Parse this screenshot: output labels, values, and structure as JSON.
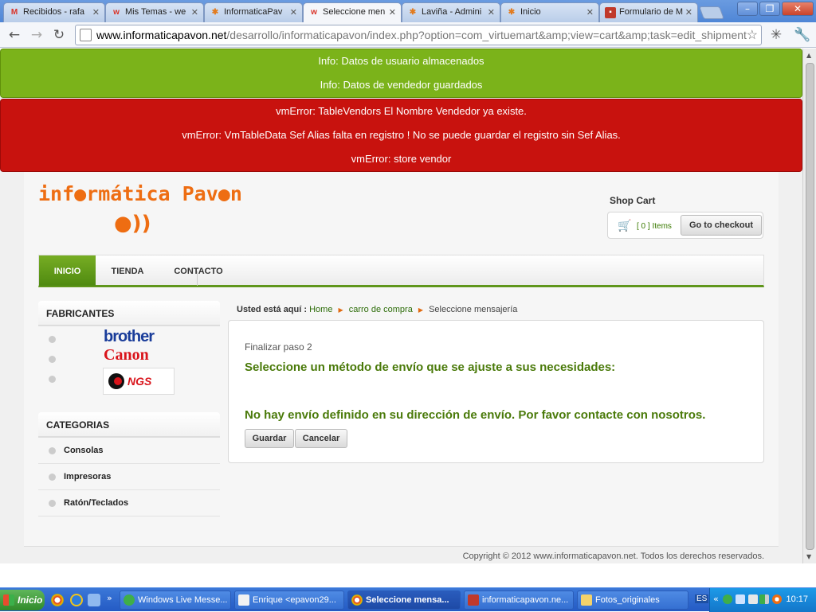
{
  "browser": {
    "tabs": [
      {
        "label": "Recibidos - rafa",
        "icon": "gmail-icon"
      },
      {
        "label": "Mis Temas - we",
        "icon": "w-logo-icon"
      },
      {
        "label": "InformaticaPav",
        "icon": "joomla-icon"
      },
      {
        "label": "Seleccione men",
        "icon": "w-logo-icon",
        "active": true
      },
      {
        "label": "Laviña - Admini",
        "icon": "joomla-icon"
      },
      {
        "label": "Inicio",
        "icon": "joomla-icon"
      },
      {
        "label": "Formulario de M",
        "icon": "form-icon"
      }
    ],
    "url_host": "www.informaticapavon.net",
    "url_path": "/desarrollo/informaticapavon/index.php?option=com_virtuemart&amp;view=cart&amp;task=edit_shipment"
  },
  "messages": {
    "info": [
      "Info: Datos de usuario almacenados",
      "Info: Datos de vendedor guardados"
    ],
    "error": [
      "vmError: TableVendors El Nombre Vendedor ya existe.",
      "vmError: VmTableData Sef Alias falta en registro ! No se puede guardar el registro sin Sef Alias.",
      "vmError: store vendor"
    ]
  },
  "site": {
    "logo_text": "inf●rmática Pav●n",
    "logo_waves": "●))",
    "cart": {
      "title": "Shop Cart",
      "items": "[ 0 ] Items",
      "checkout": "Go to checkout"
    },
    "nav": [
      "INICIO",
      "TIENDA",
      "CONTACTO"
    ],
    "fabricantes": {
      "title": "FABRICANTES",
      "brands": [
        "brother",
        "Canon",
        "NGS"
      ]
    },
    "categorias": {
      "title": "CATEGORIAS",
      "items": [
        "Consolas",
        "Impresoras",
        "Ratón/Teclados"
      ]
    },
    "breadcrumb": {
      "prefix": "Usted está aquí :",
      "home": "Home",
      "cart": "carro de compra",
      "current": "Seleccione mensajería"
    },
    "main": {
      "step": "Finalizar paso 2",
      "heading": "Seleccione un método de envío que se ajuste a sus necesidades:",
      "notice": "No hay envío definido en su dirección de envío. Por favor contacte con nosotros.",
      "save": "Guardar",
      "cancel": "Cancelar"
    },
    "copyright": "Copyright © 2012 www.informaticapavon.net. Todos los derechos reservados."
  },
  "taskbar": {
    "start": "Inicio",
    "tasks": [
      {
        "label": "Windows Live Messe...",
        "icon": "messenger-icon"
      },
      {
        "label": "Enrique <epavon29...",
        "icon": "mail-icon"
      },
      {
        "label": "Seleccione mensa...",
        "icon": "chrome-icon",
        "active": true
      },
      {
        "label": "informaticapavon.ne...",
        "icon": "filezilla-icon"
      },
      {
        "label": "Fotos_originales",
        "icon": "folder-icon"
      }
    ],
    "lang": "ES",
    "clock": "10:17"
  },
  "colors": {
    "info_bg": "#7bb31a",
    "error_bg": "#c8120e",
    "accent_green": "#4a7a0a",
    "logo_orange": "#ee6d12"
  }
}
